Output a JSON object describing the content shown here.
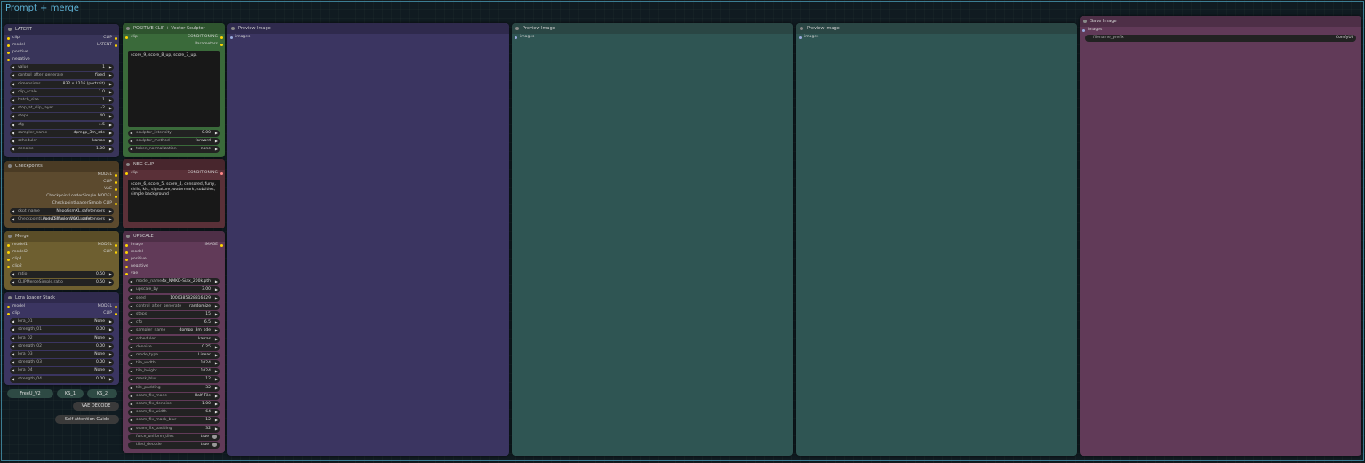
{
  "group_title": "Prompt + merge",
  "latent": {
    "title": "LATENT",
    "inputs": [
      "clip",
      "model",
      "positive",
      "negative"
    ],
    "outputs": [
      "CLIP",
      "LATENT"
    ],
    "widgets": [
      {
        "label": "value",
        "value": "1"
      },
      {
        "label": "control_after_generate",
        "value": "fixed"
      },
      {
        "label": "dimensions",
        "value": "832 x 1216   (portrait)"
      },
      {
        "label": "clip_scale",
        "value": "1.0"
      },
      {
        "label": "batch_size",
        "value": "1"
      },
      {
        "label": "stop_at_clip_layer",
        "value": "-2"
      },
      {
        "label": "steps",
        "value": "40"
      },
      {
        "label": "cfg",
        "value": "4.5"
      },
      {
        "label": "sampler_name",
        "value": "dpmpp_3m_sde"
      },
      {
        "label": "scheduler",
        "value": "karras"
      },
      {
        "label": "denoise",
        "value": "1.00"
      }
    ]
  },
  "checkpoints": {
    "title": "Checkpoints",
    "outputs": [
      "MODEL",
      "CLIP",
      "VAE",
      "CheckpointLoaderSimple MODEL",
      "CheckpointLoaderSimple CLIP"
    ],
    "widgets": [
      {
        "label": "ckpt_name",
        "value": "NepotismXL.safetensors"
      },
      {
        "label": "CheckpointLoaderSimple.ckpt_name",
        "value": "PonyDiffusionV6XL.safetensors"
      }
    ]
  },
  "merge": {
    "title": "Merge",
    "inputs": [
      "model1",
      "model2",
      "clip1",
      "clip2"
    ],
    "outputs": [
      "MODEL",
      "CLIP"
    ],
    "widgets": [
      {
        "label": "ratio",
        "value": "0.50"
      },
      {
        "label": "CLIPMergeSimple.ratio",
        "value": "0.50"
      }
    ]
  },
  "lora": {
    "title": "Lora Loader Stack",
    "inputs": [
      "model",
      "clip"
    ],
    "outputs": [
      "MODEL",
      "CLIP"
    ],
    "widgets": [
      {
        "label": "lora_01",
        "value": "None"
      },
      {
        "label": "strength_01",
        "value": "0.00"
      },
      {
        "label": "lora_02",
        "value": "None"
      },
      {
        "label": "strength_02",
        "value": "0.00"
      },
      {
        "label": "lora_03",
        "value": "None"
      },
      {
        "label": "strength_03",
        "value": "0.00"
      },
      {
        "label": "lora_04",
        "value": "None"
      },
      {
        "label": "strength_04",
        "value": "0.00"
      }
    ]
  },
  "positive_clip": {
    "title": "POSITIVE CLIP + Vector Sculptor",
    "input": "clip",
    "outputs": [
      "CONDITIONING",
      "Parameters"
    ],
    "text": "score_9, score_8_up, score_7_up,",
    "widgets": [
      {
        "label": "sculptor_intensity",
        "value": "0.00"
      },
      {
        "label": "sculptor_method",
        "value": "forward"
      },
      {
        "label": "token_normalization",
        "value": "none"
      }
    ]
  },
  "neg_clip": {
    "title": "NEG CLIP",
    "input": "clip",
    "output": "CONDITIONING",
    "text": "score_6, score_5, score_4, censored, furry, child, kid, signature, watermark, subtitles, simple background"
  },
  "upscale": {
    "title": "UPSCALE",
    "inputs": [
      "image",
      "model",
      "positive",
      "negative",
      "vae"
    ],
    "output": "IMAGE",
    "widgets": [
      {
        "label": "model_name",
        "value": "4x_NMKD-Siax_200k.pth"
      },
      {
        "label": "upscale_by",
        "value": "3.00"
      },
      {
        "label": "seed",
        "value": "1000385828816429"
      },
      {
        "label": "control_after_generate",
        "value": "randomize"
      },
      {
        "label": "steps",
        "value": "15"
      },
      {
        "label": "cfg",
        "value": "6.5"
      },
      {
        "label": "sampler_name",
        "value": "dpmpp_3m_sde"
      },
      {
        "label": "scheduler",
        "value": "karras"
      },
      {
        "label": "denoise",
        "value": "0.25"
      },
      {
        "label": "mode_type",
        "value": "Linear"
      },
      {
        "label": "tile_width",
        "value": "1024"
      },
      {
        "label": "tile_height",
        "value": "1024"
      },
      {
        "label": "mask_blur",
        "value": "12"
      },
      {
        "label": "tile_padding",
        "value": "32"
      },
      {
        "label": "seam_fix_mode",
        "value": "Half Tile"
      },
      {
        "label": "seam_fix_denoise",
        "value": "1.00"
      },
      {
        "label": "seam_fix_width",
        "value": "64"
      },
      {
        "label": "seam_fix_mask_blur",
        "value": "12"
      },
      {
        "label": "seam_fix_padding",
        "value": "32"
      }
    ],
    "toggles": [
      {
        "label": "force_uniform_tiles",
        "value": "true"
      },
      {
        "label": "tiled_decode",
        "value": "true"
      }
    ]
  },
  "preview1": {
    "title": "Preview Image",
    "input": "images"
  },
  "preview2": {
    "title": "Preview Image",
    "input": "images"
  },
  "preview3": {
    "title": "Preview Image",
    "input": "images"
  },
  "save": {
    "title": "Save Image",
    "input": "images",
    "widget": {
      "label": "filename_prefix",
      "value": "ComfyUI"
    }
  },
  "mini_nodes": {
    "freeu": "FreeU_V2",
    "ks1": "KS_1",
    "ks2": "KS_2",
    "vae_decode": "VAE DECODE",
    "self_attention": "Self-Attention Guide"
  },
  "colors": {
    "accent": "#5fb3d6",
    "slot_yellow": "#ffd500"
  }
}
